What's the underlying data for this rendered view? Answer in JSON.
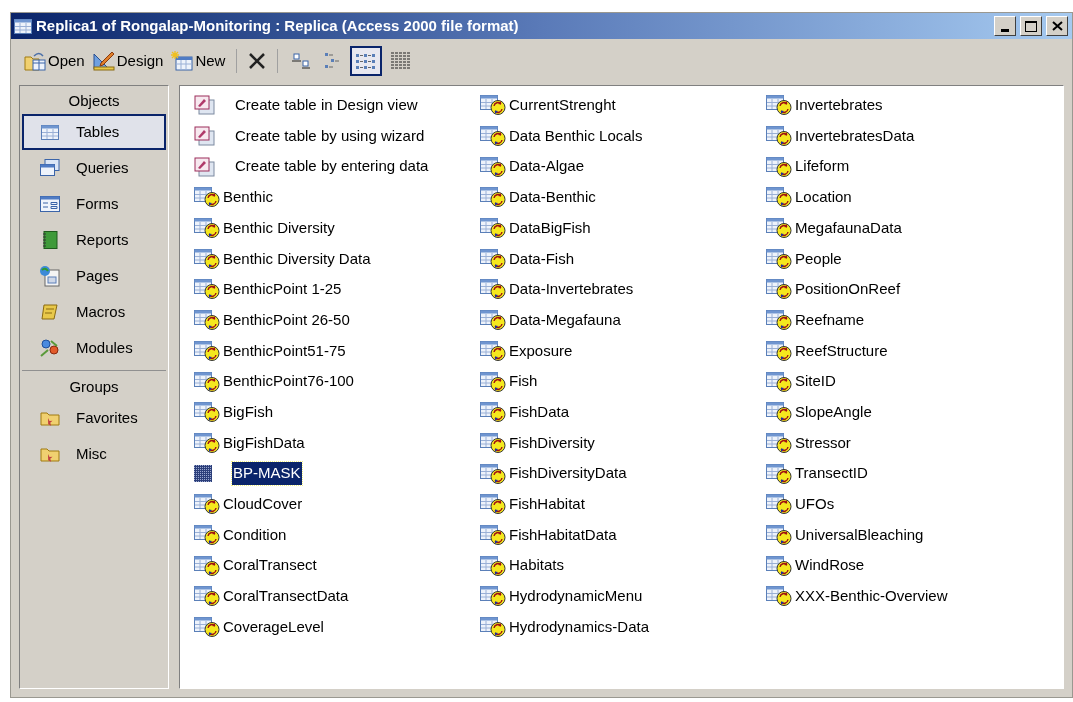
{
  "window": {
    "title": "Replica1 of Rongalap-Monitoring : Replica (Access 2000 file format)"
  },
  "toolbar": {
    "buttons": [
      {
        "kind": "open",
        "label": "Open"
      },
      {
        "kind": "design",
        "label": "Design"
      },
      {
        "kind": "new",
        "label": "New"
      },
      {
        "kind": "delete"
      }
    ],
    "views": [
      {
        "kind": "large",
        "selected": false
      },
      {
        "kind": "small",
        "selected": false
      },
      {
        "kind": "list",
        "selected": true
      },
      {
        "kind": "details",
        "selected": false
      }
    ]
  },
  "sidebar": {
    "sections": [
      {
        "header": "Objects",
        "items": [
          {
            "kind": "tables",
            "label": "Tables",
            "selected": true
          },
          {
            "kind": "queries",
            "label": "Queries",
            "selected": false
          },
          {
            "kind": "forms",
            "label": "Forms",
            "selected": false
          },
          {
            "kind": "reports",
            "label": "Reports",
            "selected": false
          },
          {
            "kind": "pages",
            "label": "Pages",
            "selected": false
          },
          {
            "kind": "macros",
            "label": "Macros",
            "selected": false
          },
          {
            "kind": "modules",
            "label": "Modules",
            "selected": false
          }
        ]
      },
      {
        "header": "Groups",
        "items": [
          {
            "kind": "group",
            "label": "Favorites",
            "selected": false
          },
          {
            "kind": "group",
            "label": "Misc",
            "selected": false
          }
        ]
      }
    ]
  },
  "list": {
    "items": [
      {
        "kind": "wizard",
        "label": "Create table in Design view",
        "selected": false
      },
      {
        "kind": "wizard",
        "label": "Create table by using wizard",
        "selected": false
      },
      {
        "kind": "wizard",
        "label": "Create table by entering data",
        "selected": false
      },
      {
        "kind": "replicated",
        "label": "Benthic",
        "selected": false
      },
      {
        "kind": "replicated",
        "label": "Benthic Diversity",
        "selected": false
      },
      {
        "kind": "replicated",
        "label": "Benthic Diversity Data",
        "selected": false
      },
      {
        "kind": "replicated",
        "label": "BenthicPoint 1-25",
        "selected": false
      },
      {
        "kind": "replicated",
        "label": "BenthicPoint 26-50",
        "selected": false
      },
      {
        "kind": "replicated",
        "label": "BenthicPoint51-75",
        "selected": false
      },
      {
        "kind": "replicated",
        "label": "BenthicPoint76-100",
        "selected": false
      },
      {
        "kind": "replicated",
        "label": "BigFish",
        "selected": false
      },
      {
        "kind": "replicated",
        "label": "BigFishData",
        "selected": false
      },
      {
        "kind": "local",
        "label": "BP-MASK",
        "selected": true
      },
      {
        "kind": "replicated",
        "label": "CloudCover",
        "selected": false
      },
      {
        "kind": "replicated",
        "label": "Condition",
        "selected": false
      },
      {
        "kind": "replicated",
        "label": "CoralTransect",
        "selected": false
      },
      {
        "kind": "replicated",
        "label": "CoralTransectData",
        "selected": false
      },
      {
        "kind": "replicated",
        "label": "CoverageLevel",
        "selected": false
      },
      {
        "kind": "replicated",
        "label": "CurrentStrenght",
        "selected": false
      },
      {
        "kind": "replicated",
        "label": "Data Benthic Locals",
        "selected": false
      },
      {
        "kind": "replicated",
        "label": "Data-Algae",
        "selected": false
      },
      {
        "kind": "replicated",
        "label": "Data-Benthic",
        "selected": false
      },
      {
        "kind": "replicated",
        "label": "DataBigFish",
        "selected": false
      },
      {
        "kind": "replicated",
        "label": "Data-Fish",
        "selected": false
      },
      {
        "kind": "replicated",
        "label": "Data-Invertebrates",
        "selected": false
      },
      {
        "kind": "replicated",
        "label": "Data-Megafauna",
        "selected": false
      },
      {
        "kind": "replicated",
        "label": "Exposure",
        "selected": false
      },
      {
        "kind": "replicated",
        "label": "Fish",
        "selected": false
      },
      {
        "kind": "replicated",
        "label": "FishData",
        "selected": false
      },
      {
        "kind": "replicated",
        "label": "FishDiversity",
        "selected": false
      },
      {
        "kind": "replicated",
        "label": "FishDiversityData",
        "selected": false
      },
      {
        "kind": "replicated",
        "label": "FishHabitat",
        "selected": false
      },
      {
        "kind": "replicated",
        "label": "FishHabitatData",
        "selected": false
      },
      {
        "kind": "replicated",
        "label": "Habitats",
        "selected": false
      },
      {
        "kind": "replicated",
        "label": "HydrodynamicMenu",
        "selected": false
      },
      {
        "kind": "replicated",
        "label": "Hydrodynamics-Data",
        "selected": false
      },
      {
        "kind": "replicated",
        "label": "Invertebrates",
        "selected": false
      },
      {
        "kind": "replicated",
        "label": "InvertebratesData",
        "selected": false
      },
      {
        "kind": "replicated",
        "label": "Lifeform",
        "selected": false
      },
      {
        "kind": "replicated",
        "label": "Location",
        "selected": false
      },
      {
        "kind": "replicated",
        "label": "MegafaunaData",
        "selected": false
      },
      {
        "kind": "replicated",
        "label": "People",
        "selected": false
      },
      {
        "kind": "replicated",
        "label": "PositionOnReef",
        "selected": false
      },
      {
        "kind": "replicated",
        "label": "Reefname",
        "selected": false
      },
      {
        "kind": "replicated",
        "label": "ReefStructure",
        "selected": false
      },
      {
        "kind": "replicated",
        "label": "SiteID",
        "selected": false
      },
      {
        "kind": "replicated",
        "label": "SlopeAngle",
        "selected": false
      },
      {
        "kind": "replicated",
        "label": "Stressor",
        "selected": false
      },
      {
        "kind": "replicated",
        "label": "TransectID",
        "selected": false
      },
      {
        "kind": "replicated",
        "label": "UFOs",
        "selected": false
      },
      {
        "kind": "replicated",
        "label": "UniversalBleaching",
        "selected": false
      },
      {
        "kind": "replicated",
        "label": "WindRose",
        "selected": false
      },
      {
        "kind": "replicated",
        "label": "XXX-Benthic-Overview",
        "selected": false
      }
    ]
  }
}
